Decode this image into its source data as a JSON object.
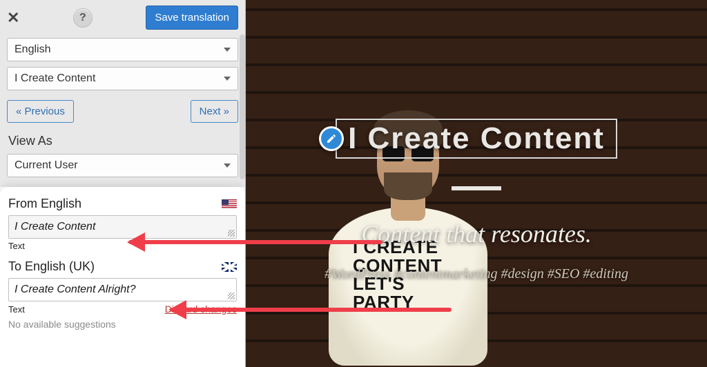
{
  "topbar": {
    "help_symbol": "?",
    "save_label": "Save translation"
  },
  "selects": {
    "language": "English",
    "content_item": "I Create Content",
    "view_as_label": "View As",
    "view_as_value": "Current User"
  },
  "nav": {
    "prev": "« Previous",
    "next": "Next »"
  },
  "editor": {
    "from_label": "From English",
    "from_value": "I Create Content",
    "from_type": "Text",
    "to_label": "To English (UK)",
    "to_value": "I Create Content Alright?",
    "to_type": "Text",
    "discard": "Discard changes",
    "no_suggestions": "No available suggestions"
  },
  "preview": {
    "title": "I Create Content",
    "tagline": "Content that resonates.",
    "hashtags": "#WordPress #contentmarketing #design #SEO #editing",
    "shirt": "I CREATE CONTENT LET'S PARTY"
  }
}
